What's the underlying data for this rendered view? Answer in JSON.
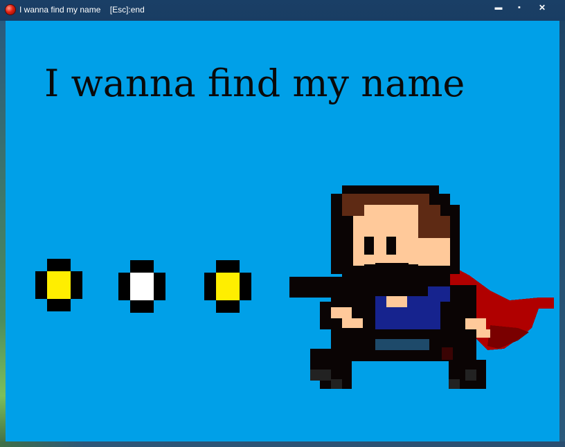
{
  "window": {
    "title": "I wanna find my name    [Esc]:end",
    "minimize_label": "▬",
    "maximize_label": "▪",
    "close_label": "✕"
  },
  "game": {
    "title": "I wanna find my name",
    "bullets": [
      {
        "name": "bullet-yellow-1",
        "color": "#ffee00"
      },
      {
        "name": "bullet-white",
        "color": "#ffffff"
      },
      {
        "name": "bullet-yellow-2",
        "color": "#ffee00"
      }
    ],
    "hero": {
      "name": "caped-hero-with-gun",
      "colors": {
        "outline": "#0a0404",
        "hair": "#5e2a14",
        "skin": "#ffc99a",
        "shirt": "#16238e",
        "pants": "#1e4a6a",
        "cape": "#b00000",
        "cape_dark": "#7a0000"
      }
    }
  },
  "colors": {
    "sky": "#00a0e8"
  }
}
